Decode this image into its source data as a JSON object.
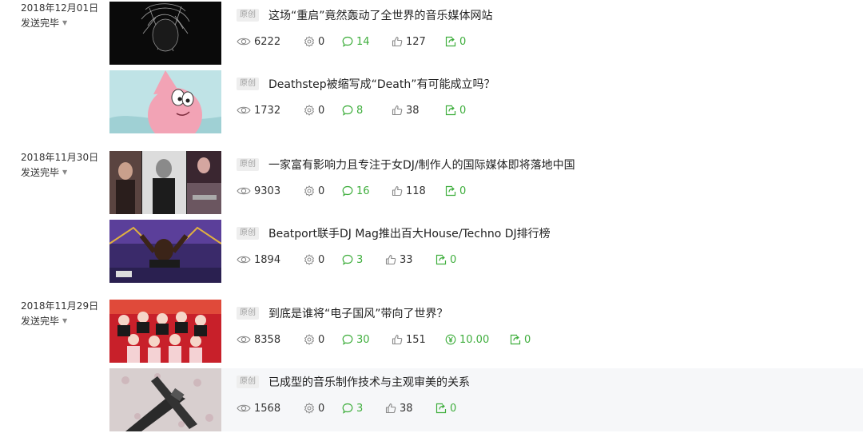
{
  "badge_label": "原创",
  "groups": [
    {
      "date": "2018年12月01日",
      "status": "发送完毕",
      "articles": [
        {
          "title": "这场“重启”竟然轰动了全世界的音乐媒体网站",
          "views": "6222",
          "shares": "0",
          "comments": "14",
          "likes": "127",
          "reposts": "0"
        },
        {
          "title": "Deathstep被缩写成“Death”有可能成立吗？",
          "views": "1732",
          "shares": "0",
          "comments": "8",
          "likes": "38",
          "reposts": "0"
        }
      ]
    },
    {
      "date": "2018年11月30日",
      "status": "发送完毕",
      "articles": [
        {
          "title": "一家富有影响力且专注于女DJ/制作人的国际媒体即将落地中国",
          "views": "9303",
          "shares": "0",
          "comments": "16",
          "likes": "118",
          "reposts": "0"
        },
        {
          "title": "Beatport联手DJ Mag推出百大House/Techno DJ排行榜",
          "views": "1894",
          "shares": "0",
          "comments": "3",
          "likes": "33",
          "reposts": "0"
        }
      ]
    },
    {
      "date": "2018年11月29日",
      "status": "发送完毕",
      "articles": [
        {
          "title": "到底是谁将“电子国风”带向了世界？",
          "views": "8358",
          "shares": "0",
          "comments": "30",
          "likes": "151",
          "reward": "10.00",
          "reposts": "0"
        },
        {
          "title": "已成型的音乐制作技术与主观审美的关系",
          "views": "1568",
          "shares": "0",
          "comments": "3",
          "likes": "38",
          "reposts": "0"
        }
      ]
    }
  ],
  "colors": {
    "accent_green": "#3fae3d",
    "highlight_row": "#f6f7f9"
  }
}
